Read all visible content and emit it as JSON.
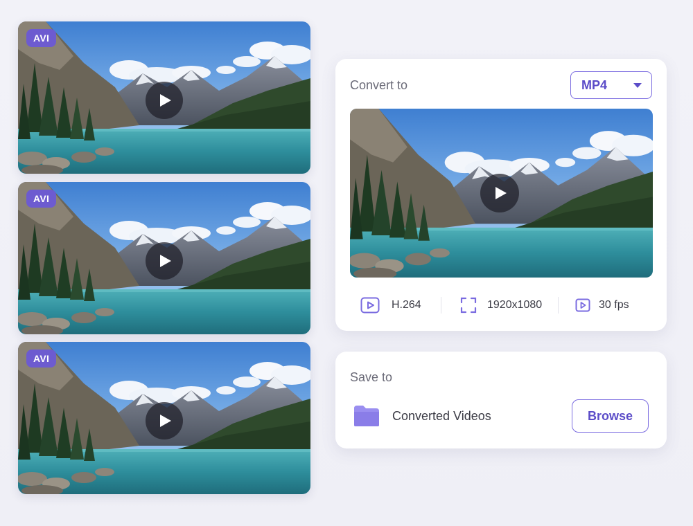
{
  "videos": [
    {
      "format_badge": "AVI"
    },
    {
      "format_badge": "AVI"
    },
    {
      "format_badge": "AVI"
    }
  ],
  "convert": {
    "label": "Convert to",
    "format": "MP4",
    "specs": {
      "codec": "H.264",
      "resolution": "1920x1080",
      "framerate": "30 fps"
    }
  },
  "save": {
    "label": "Save to",
    "folder": "Converted Videos",
    "browse_label": "Browse"
  },
  "colors": {
    "accent": "#6d5bd0",
    "accent_text": "#5b4cc8",
    "folder": "#9a8ef0"
  },
  "icons": {
    "play": "play-icon",
    "codec": "video-file-icon",
    "resolution": "fullscreen-frame-icon",
    "framerate": "video-play-small-icon",
    "folder": "folder-icon",
    "dropdown": "chevron-down-icon"
  }
}
